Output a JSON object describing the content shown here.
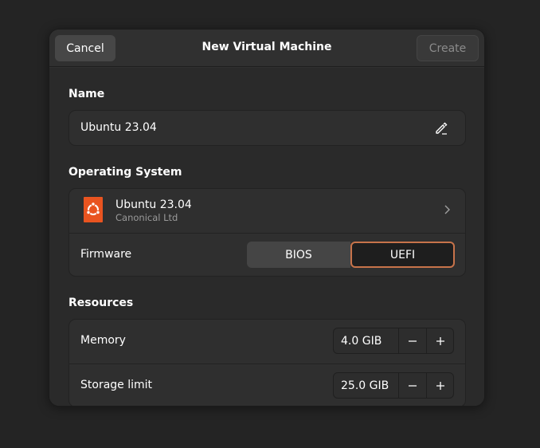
{
  "header": {
    "title": "New Virtual Machine",
    "cancel_label": "Cancel",
    "create_label": "Create"
  },
  "name_section": {
    "label": "Name",
    "value": "Ubuntu 23.04"
  },
  "os_section": {
    "label": "Operating System",
    "os_name": "Ubuntu 23.04",
    "os_vendor": "Canonical Ltd",
    "firmware_label": "Firmware",
    "firmware_options": [
      "BIOS",
      "UEFI"
    ],
    "firmware_selected": "UEFI"
  },
  "resources_section": {
    "label": "Resources",
    "memory_label": "Memory",
    "memory_value": "4.0 GIB",
    "storage_label": "Storage limit",
    "storage_value": "25.0 GIB"
  },
  "colors": {
    "accent": "#c7734a",
    "ubuntu_orange": "#e95420",
    "background": "#242424",
    "dialog": "#303030"
  },
  "icons": [
    "edit-icon",
    "ubuntu-logo-icon",
    "chevron-right-icon",
    "minus-icon",
    "plus-icon"
  ]
}
